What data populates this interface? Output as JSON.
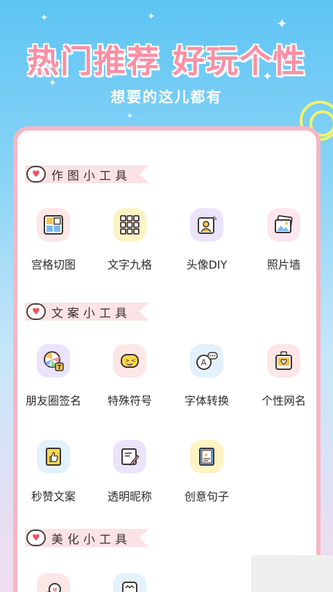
{
  "banner": {
    "headline": "热门推荐  好玩个性",
    "subline": "想要的这儿都有"
  },
  "sections": [
    {
      "title": "作图小工具",
      "tools": [
        {
          "label": "宫格切图",
          "icon": "grid-cut-icon",
          "bg": "#fde6e6"
        },
        {
          "label": "文字九格",
          "icon": "text-nine-grid-icon",
          "bg": "#fdf3c4"
        },
        {
          "label": "头像DIY",
          "icon": "avatar-diy-icon",
          "bg": "#ebe3fb"
        },
        {
          "label": "照片墙",
          "icon": "photo-wall-icon",
          "bg": "#fde6ee"
        }
      ]
    },
    {
      "title": "文案小工具",
      "tools": [
        {
          "label": "朋友圈签名",
          "icon": "moments-signature-icon",
          "bg": "#ebe3fb"
        },
        {
          "label": "特殊符号",
          "icon": "special-symbol-icon",
          "bg": "#fde6e6"
        },
        {
          "label": "字体转换",
          "icon": "font-convert-icon",
          "bg": "#e2f1fb"
        },
        {
          "label": "个性网名",
          "icon": "nickname-icon",
          "bg": "#fde6e6"
        },
        {
          "label": "秒赞文案",
          "icon": "like-copy-icon",
          "bg": "#e2f1fb"
        },
        {
          "label": "透明昵称",
          "icon": "transparent-nickname-icon",
          "bg": "#ebe3fb"
        },
        {
          "label": "创意句子",
          "icon": "creative-sentence-icon",
          "bg": "#fdf3c4"
        }
      ]
    },
    {
      "title": "美化小工具",
      "tools": [
        {
          "label": "",
          "icon": "beautify-heart-icon",
          "bg": "#fde6e6"
        },
        {
          "label": "",
          "icon": "beautify-frame-icon",
          "bg": "#e2f1fb"
        }
      ]
    }
  ]
}
